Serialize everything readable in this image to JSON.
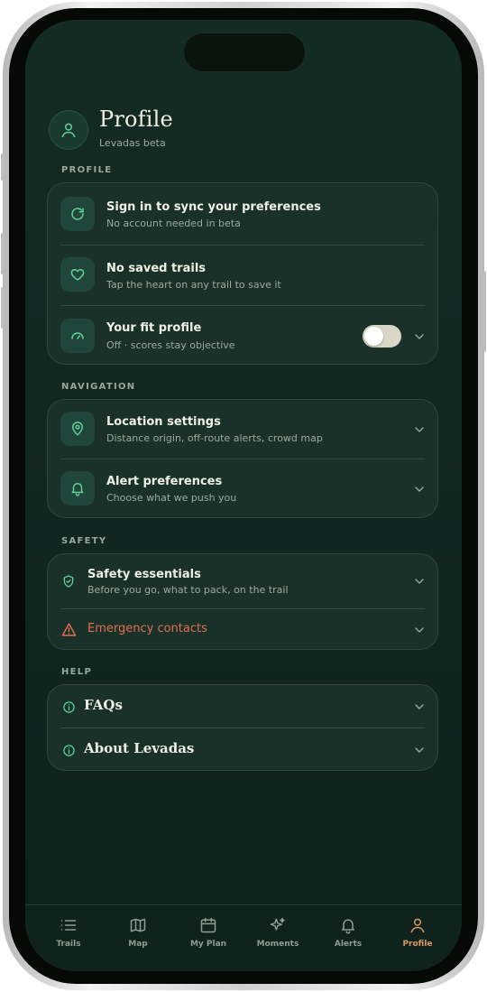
{
  "header": {
    "title": "Profile",
    "subtitle": "Levadas beta"
  },
  "sections": {
    "profile": {
      "label": "PROFILE",
      "items": [
        {
          "title": "Sign in to sync your preferences",
          "subtitle": "No account needed in beta",
          "icon": "refresh-icon"
        },
        {
          "title": "No saved trails",
          "subtitle": "Tap the heart on any trail to save it",
          "icon": "heart-icon"
        },
        {
          "title": "Your fit profile",
          "subtitle": "Off · scores stay objective",
          "icon": "gauge-icon",
          "toggle_on": false
        }
      ]
    },
    "navigation": {
      "label": "NAVIGATION",
      "items": [
        {
          "title": "Location settings",
          "subtitle": "Distance origin, off-route alerts, crowd map",
          "icon": "map-pin-icon"
        },
        {
          "title": "Alert preferences",
          "subtitle": "Choose what we push you",
          "icon": "bell-icon"
        }
      ]
    },
    "safety": {
      "label": "SAFETY",
      "items": [
        {
          "title": "Safety essentials",
          "subtitle": "Before you go, what to pack, on the trail",
          "icon": "shield-check-icon"
        },
        {
          "title": "Emergency contacts",
          "icon": "warning-triangle-icon"
        }
      ]
    },
    "help": {
      "label": "HELP",
      "items": [
        {
          "title": "FAQs",
          "icon": "info-icon"
        },
        {
          "title": "About Levadas",
          "icon": "info-icon"
        }
      ]
    }
  },
  "tabbar": {
    "tabs": [
      {
        "label": "Trails",
        "icon": "list-icon"
      },
      {
        "label": "Map",
        "icon": "map-icon"
      },
      {
        "label": "My Plan",
        "icon": "calendar-icon"
      },
      {
        "label": "Moments",
        "icon": "sparkles-icon"
      },
      {
        "label": "Alerts",
        "icon": "bell-icon"
      },
      {
        "label": "Profile",
        "icon": "user-icon"
      }
    ],
    "active": "Profile"
  },
  "colors": {
    "background": "#112821",
    "card": "#193129",
    "accent_green": "#5fd19a",
    "danger": "#e0704f",
    "active_tab": "#d99a62"
  }
}
